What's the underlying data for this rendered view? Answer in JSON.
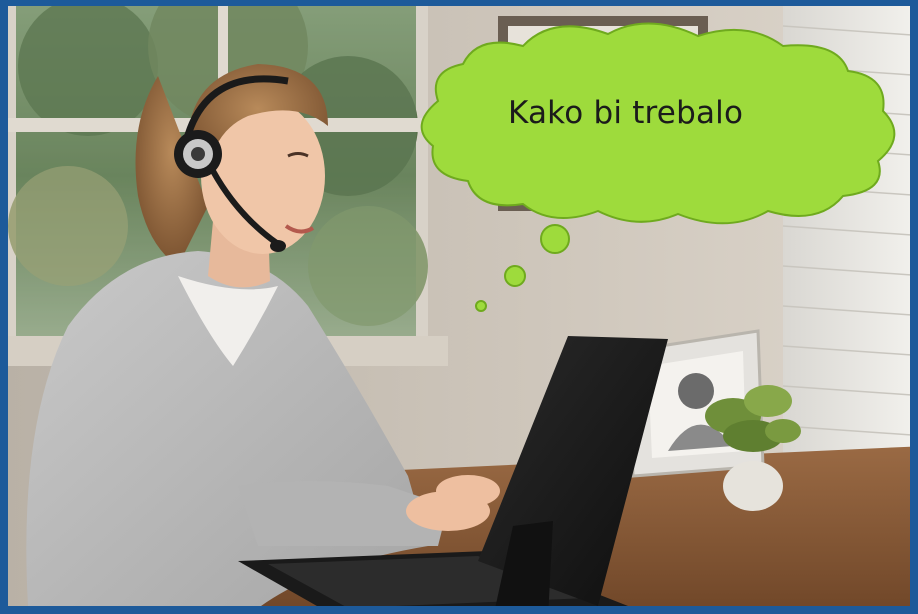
{
  "speech_bubble": {
    "text": "Kako bi trebalo",
    "fill_color": "#9edb3c",
    "stroke_color": "#6faa1e"
  },
  "frame": {
    "border_color": "#1d5a9a"
  },
  "scene": {
    "subject": "woman-with-headset-typing-on-laptop"
  }
}
